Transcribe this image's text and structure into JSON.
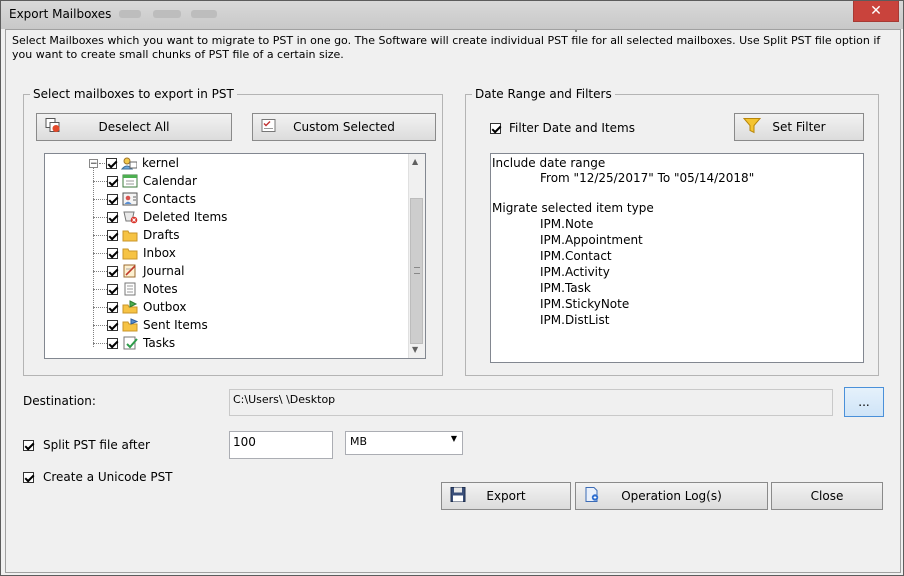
{
  "window": {
    "title": "Export Mailboxes",
    "close_symbol": "✕"
  },
  "intro_text": "Select Mailboxes which you want to migrate to PST in one go. The Software will create individual PST file for all selected mailboxes. Use Split PST file option if you want to create small chunks of PST file of a certain size.",
  "mailbox_group": {
    "legend": "Select mailboxes to export in PST",
    "deselect_label": "Deselect All",
    "custom_label": "Custom Selected",
    "tree": {
      "root": {
        "label": "kernel",
        "checked": true,
        "expander": "−"
      },
      "folders": [
        {
          "label": "Calendar",
          "checked": true,
          "icon": "calendar-icon"
        },
        {
          "label": "Contacts",
          "checked": true,
          "icon": "contacts-icon"
        },
        {
          "label": "Deleted Items",
          "checked": true,
          "icon": "deleted-items-icon"
        },
        {
          "label": "Drafts",
          "checked": true,
          "icon": "folder-icon"
        },
        {
          "label": "Inbox",
          "checked": true,
          "icon": "folder-icon"
        },
        {
          "label": "Journal",
          "checked": true,
          "icon": "journal-icon"
        },
        {
          "label": "Notes",
          "checked": true,
          "icon": "notes-icon"
        },
        {
          "label": "Outbox",
          "checked": true,
          "icon": "outbox-icon"
        },
        {
          "label": "Sent Items",
          "checked": true,
          "icon": "sent-items-icon"
        },
        {
          "label": "Tasks",
          "checked": true,
          "icon": "tasks-icon"
        }
      ]
    }
  },
  "filter_group": {
    "legend": "Date Range and Filters",
    "filter_checkbox_label": "Filter Date and Items",
    "filter_checked": true,
    "set_filter_label": "Set Filter",
    "summary": {
      "date_heading": "Include date range",
      "date_range": "From \"12/25/2017\" To \"05/14/2018\"",
      "types_heading": "Migrate selected item type",
      "item_types": [
        "IPM.Note",
        "IPM.Appointment",
        "IPM.Contact",
        "IPM.Activity",
        "IPM.Task",
        "IPM.StickyNote",
        "IPM.DistList"
      ]
    }
  },
  "destination": {
    "label": "Destination:",
    "path": "C:\\Users\\      \\Desktop",
    "browse_label": "..."
  },
  "split": {
    "label": "Split PST file after",
    "checked": true,
    "size_value": "100",
    "unit_value": "MB"
  },
  "unicode": {
    "label": "Create a Unicode PST",
    "checked": true
  },
  "actions": {
    "export_label": "Export",
    "log_label": "Operation Log(s)",
    "close_label": "Close"
  }
}
